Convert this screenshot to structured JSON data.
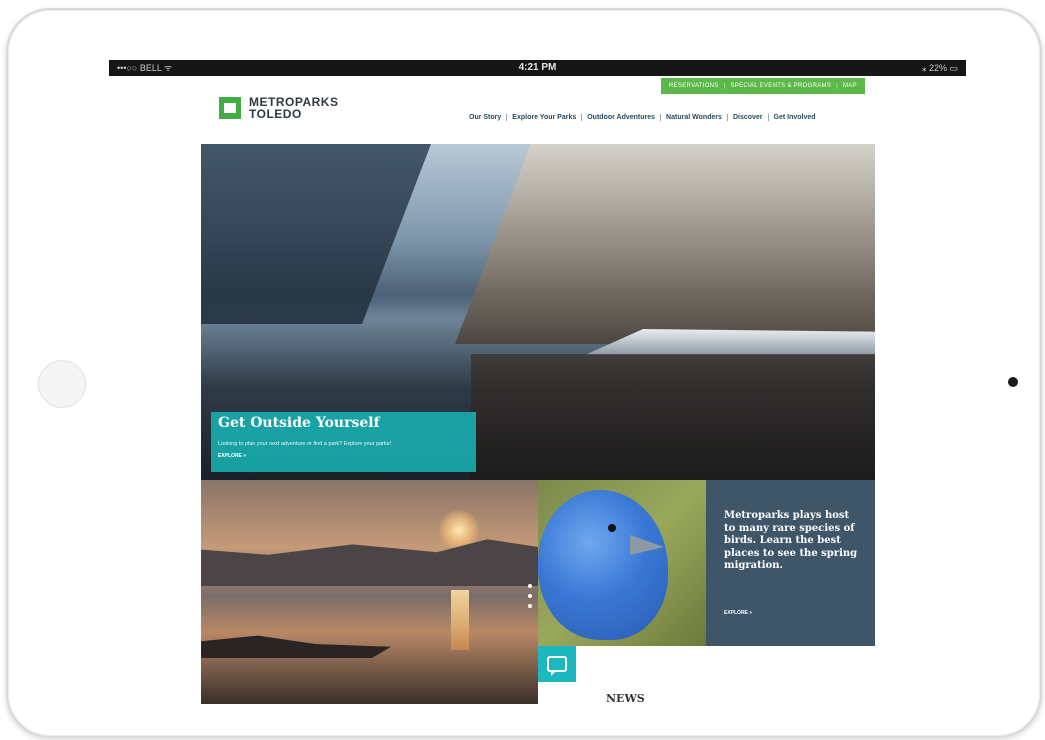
{
  "status_bar": {
    "carrier": "•••○○ BELL ᯤ",
    "time": "4:21 PM",
    "battery": "⁎ 22% ▭"
  },
  "utility_nav": {
    "items": [
      "RESERVATIONS",
      "|",
      "SPECIAL EVENTS & PROGRAMS",
      "|",
      "MAP"
    ]
  },
  "logo": {
    "line1": "METROPARKS",
    "line2": "TOLEDO"
  },
  "main_nav": {
    "items": [
      "Our Story",
      "Explore Your Parks",
      "Outdoor Adventures",
      "Natural Wonders",
      "Discover",
      "Get Involved"
    ]
  },
  "hero": {
    "title": "Get Outside Yourself",
    "description": "Looking to plan your next adventure or find a park? Explore your parks!",
    "cta": "EXPLORE »"
  },
  "birds_feature": {
    "text": "Metroparks plays host to many rare species of birds. Learn the best places to see the spring migration.",
    "cta": "EXPLORE »"
  },
  "news": {
    "heading": "NEWS"
  },
  "colors": {
    "accent_green": "#5cb848",
    "teal": "#1fb7be",
    "slate_panel": "#3f5568",
    "nav_text": "#2b4a5f"
  }
}
